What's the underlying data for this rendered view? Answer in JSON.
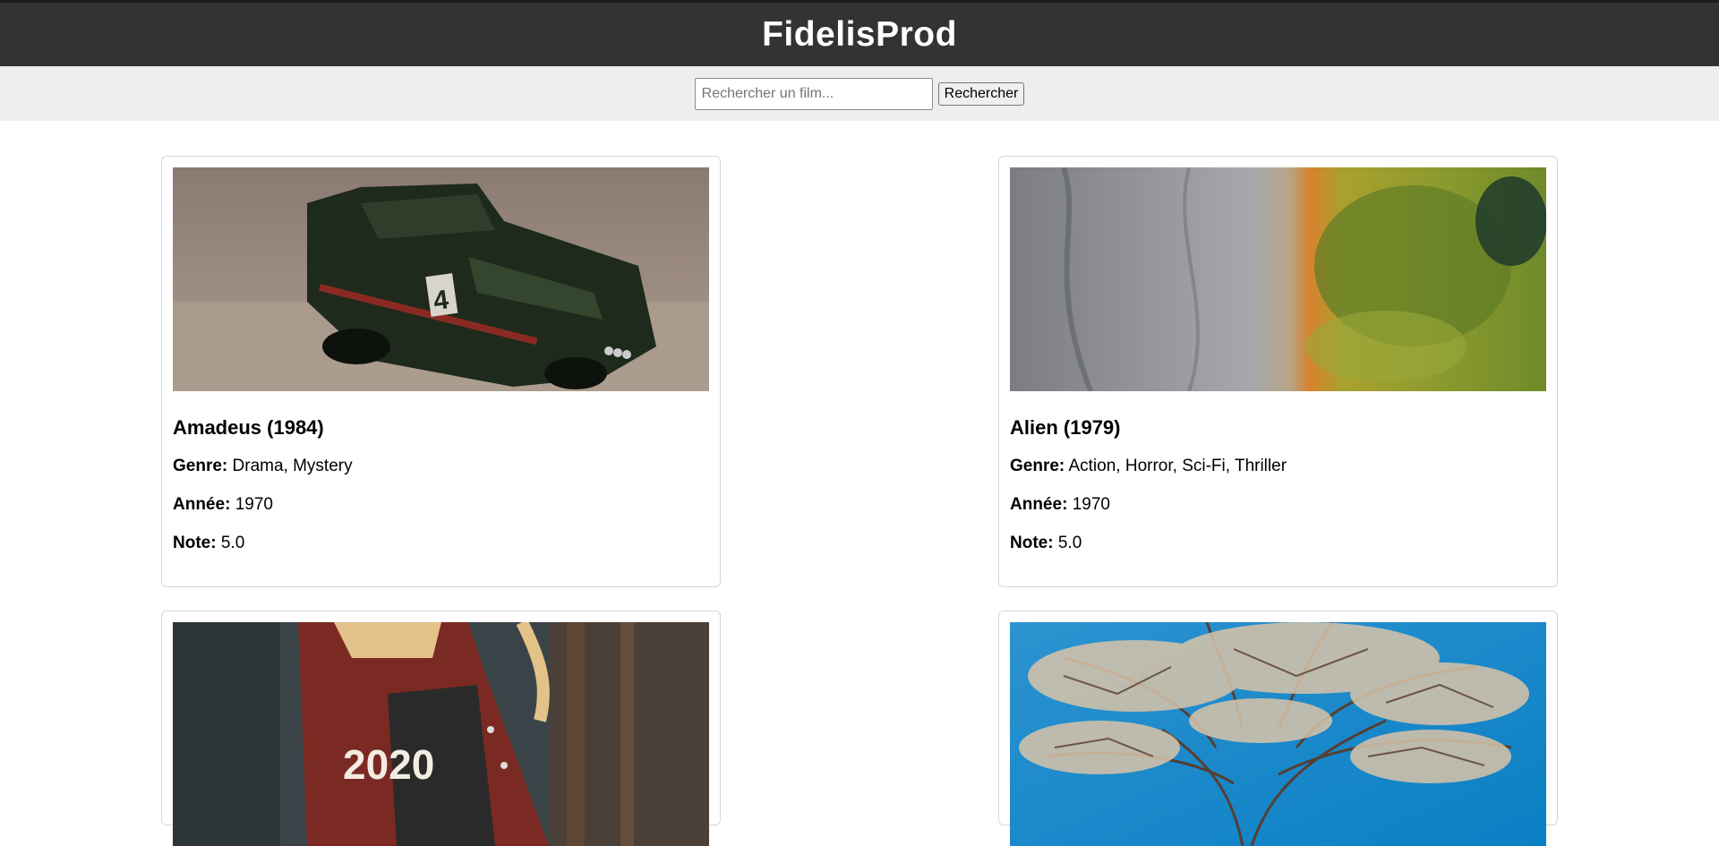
{
  "site": {
    "title": "FidelisProd"
  },
  "search": {
    "placeholder": "Rechercher un film...",
    "value": "",
    "button_label": "Rechercher"
  },
  "labels": {
    "genre": "Genre:",
    "year": "Année:",
    "rating": "Note:"
  },
  "movies": [
    {
      "title": "Amadeus (1984)",
      "genre": "Drama, Mystery",
      "year": "1970",
      "rating": "5.0",
      "image": "toy-car-photo"
    },
    {
      "title": "Alien (1979)",
      "genre": "Action, Horror, Sci-Fi, Thriller",
      "year": "1970",
      "rating": "5.0",
      "image": "aerial-landscape-photo"
    },
    {
      "image": "person-varsity-jacket-photo"
    },
    {
      "image": "tree-blue-sky-photo"
    }
  ]
}
